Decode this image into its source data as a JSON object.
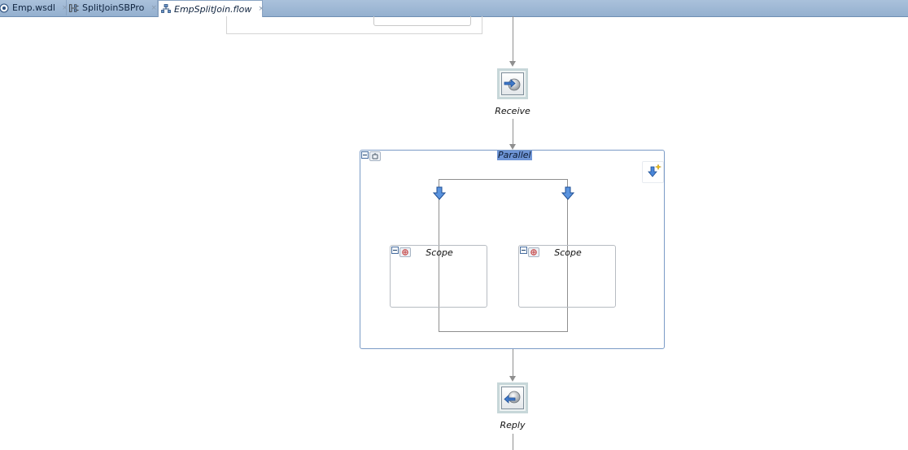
{
  "tabs": [
    {
      "label": "Emp.wsdl",
      "icon": "wsdl-file-icon",
      "active": false
    },
    {
      "label": "SplitJoinSBPro",
      "icon": "project-icon",
      "active": false
    },
    {
      "label": "EmpSplitJoin.flow",
      "icon": "flow-file-icon",
      "active": true
    }
  ],
  "tab_close_glyph": "×",
  "flow": {
    "receive": {
      "label": "Receive",
      "icon": "receive-icon"
    },
    "parallel": {
      "label": "Parallel",
      "branches": [
        {
          "scope_label": "Scope"
        },
        {
          "scope_label": "Scope"
        }
      ]
    },
    "reply": {
      "label": "Reply",
      "icon": "reply-icon"
    }
  },
  "colors": {
    "tab_bar": "#9fb8d6",
    "parallel_border": "#7b9bc6",
    "parallel_title_highlight": "#6f95d6",
    "connector": "#8f8f8f",
    "arrow_blue": "#2f6fd0"
  }
}
